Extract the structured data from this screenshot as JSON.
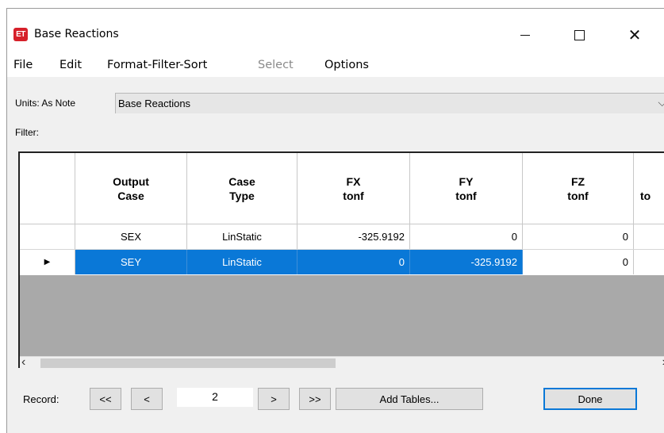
{
  "window": {
    "app_icon_text": "ET",
    "title": "Base Reactions"
  },
  "menu": {
    "file": "File",
    "edit": "Edit",
    "format": "Format-Filter-Sort",
    "select": "Select",
    "options": "Options"
  },
  "units": {
    "label": "Units:  As Note",
    "selected": "Base Reactions"
  },
  "filter": {
    "label": "Filter:"
  },
  "table": {
    "columns": [
      "",
      "Output\nCase",
      "Case\nType",
      "FX\ntonf",
      "FY\ntonf",
      "FZ\ntonf",
      "\nto"
    ],
    "rows": [
      {
        "indicator": "",
        "output_case": "SEX",
        "case_type": "LinStatic",
        "fx": "-325.9192",
        "fy": "0",
        "fz": "0"
      },
      {
        "indicator": "▶",
        "output_case": "SEY",
        "case_type": "LinStatic",
        "fx": "0",
        "fy": "-325.9192",
        "fz": "0"
      }
    ],
    "selected_row": 1
  },
  "bottom": {
    "record_label": "Record:",
    "first": "<<",
    "prev": "<",
    "record_value": "2",
    "next": ">",
    "last": ">>",
    "add_tables": "Add Tables...",
    "done": "Done"
  },
  "icons": {
    "minimize": "minimize-icon",
    "maximize": "maximize-icon",
    "close": "close-icon",
    "chevron_down": "chevron-down-icon",
    "row_pointer": "row-pointer-icon"
  },
  "colors": {
    "selection": "#0a78d7",
    "app_icon": "#d6202a"
  }
}
